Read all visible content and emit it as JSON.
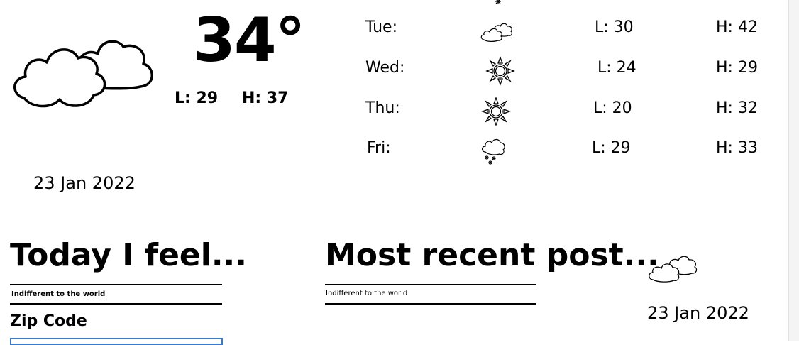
{
  "current": {
    "icon": "cloudy-icon",
    "temperature": "34°",
    "low": "L: 29",
    "high": "H: 37",
    "date": "23 Jan 2022"
  },
  "forecast": [
    {
      "day": "Tue:",
      "icon": "cloudy-icon",
      "low": "L: 30",
      "high": "H: 42"
    },
    {
      "day": "Wed:",
      "icon": "sun-icon",
      "low": "L: 24",
      "high": "H: 29"
    },
    {
      "day": "Thu:",
      "icon": "sun-icon",
      "low": "L: 20",
      "high": "H: 32"
    },
    {
      "day": "Fri:",
      "icon": "snow-icon",
      "low": "L: 29",
      "high": "H: 33"
    }
  ],
  "feel": {
    "heading": "Today I feel...",
    "status": "Indifferent to the world"
  },
  "zip": {
    "label": "Zip Code",
    "value": ""
  },
  "recent": {
    "heading": "Most recent post...",
    "text": "Indifferent to the world",
    "icon": "cloudy-icon",
    "date": "23 Jan 2022"
  }
}
